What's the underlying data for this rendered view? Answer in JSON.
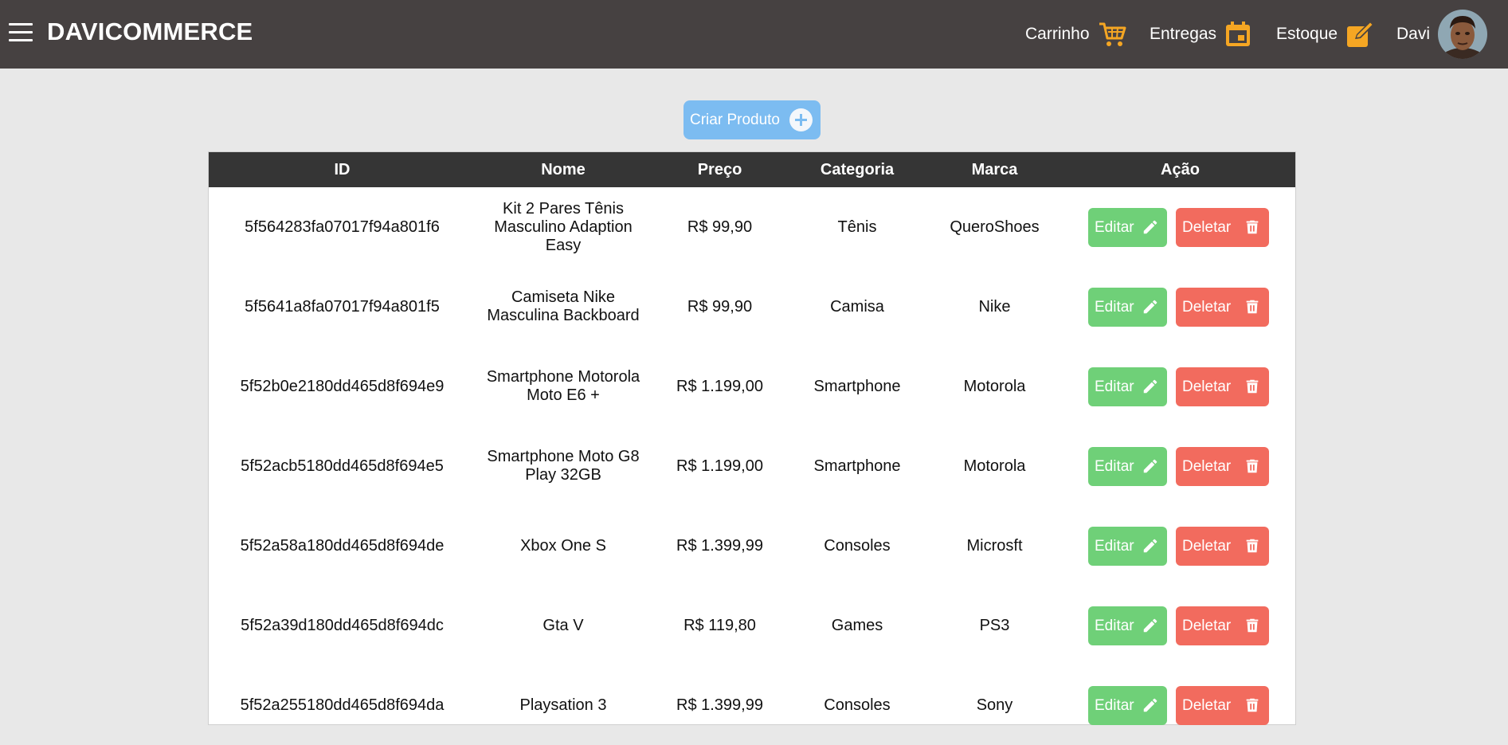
{
  "header": {
    "brand": "DAVICOMMERCE",
    "nav": {
      "cart": "Carrinho",
      "deliveries": "Entregas",
      "stock": "Estoque",
      "user": "Davi"
    },
    "accent_color": "#f5a623"
  },
  "toolbar": {
    "create_label": "Criar Produto"
  },
  "table": {
    "headers": [
      "ID",
      "Nome",
      "Preço",
      "Categoria",
      "Marca",
      "Ação"
    ],
    "rows": [
      {
        "id": "5f564283fa07017f94a801f6",
        "name": "Kit 2 Pares Tênis Masculino Adaption Easy",
        "price": "R$ 99,90",
        "category": "Tênis",
        "brand": "QueroShoes"
      },
      {
        "id": "5f5641a8fa07017f94a801f5",
        "name": "Camiseta Nike Masculina Backboard",
        "price": "R$ 99,90",
        "category": "Camisa",
        "brand": "Nike"
      },
      {
        "id": "5f52b0e2180dd465d8f694e9",
        "name": "Smartphone Motorola Moto E6 +",
        "price": "R$ 1.199,00",
        "category": "Smartphone",
        "brand": "Motorola"
      },
      {
        "id": "5f52acb5180dd465d8f694e5",
        "name": "Smartphone Moto G8 Play 32GB",
        "price": "R$ 1.199,00",
        "category": "Smartphone",
        "brand": "Motorola"
      },
      {
        "id": "5f52a58a180dd465d8f694de",
        "name": "Xbox One S",
        "price": "R$ 1.399,99",
        "category": "Consoles",
        "brand": "Microsft"
      },
      {
        "id": "5f52a39d180dd465d8f694dc",
        "name": "Gta V",
        "price": "R$ 119,80",
        "category": "Games",
        "brand": "PS3"
      },
      {
        "id": "5f52a255180dd465d8f694da",
        "name": "Playsation 3",
        "price": "R$ 1.399,99",
        "category": "Consoles",
        "brand": "Sony"
      }
    ],
    "edit_label": "Editar",
    "delete_label": "Deletar"
  },
  "icons": {
    "menu": "hamburger-icon",
    "cart": "cart-icon",
    "deliveries": "calendar-icon",
    "stock": "edit-square-icon",
    "create": "plus-circle-icon",
    "edit": "pencil-icon",
    "delete": "trash-icon"
  },
  "colors": {
    "header_bg": "#464141",
    "table_header_bg": "#353535",
    "create_button": "#7cbcf1",
    "edit_button": "#6fd078",
    "delete_button": "#f26b5e"
  }
}
